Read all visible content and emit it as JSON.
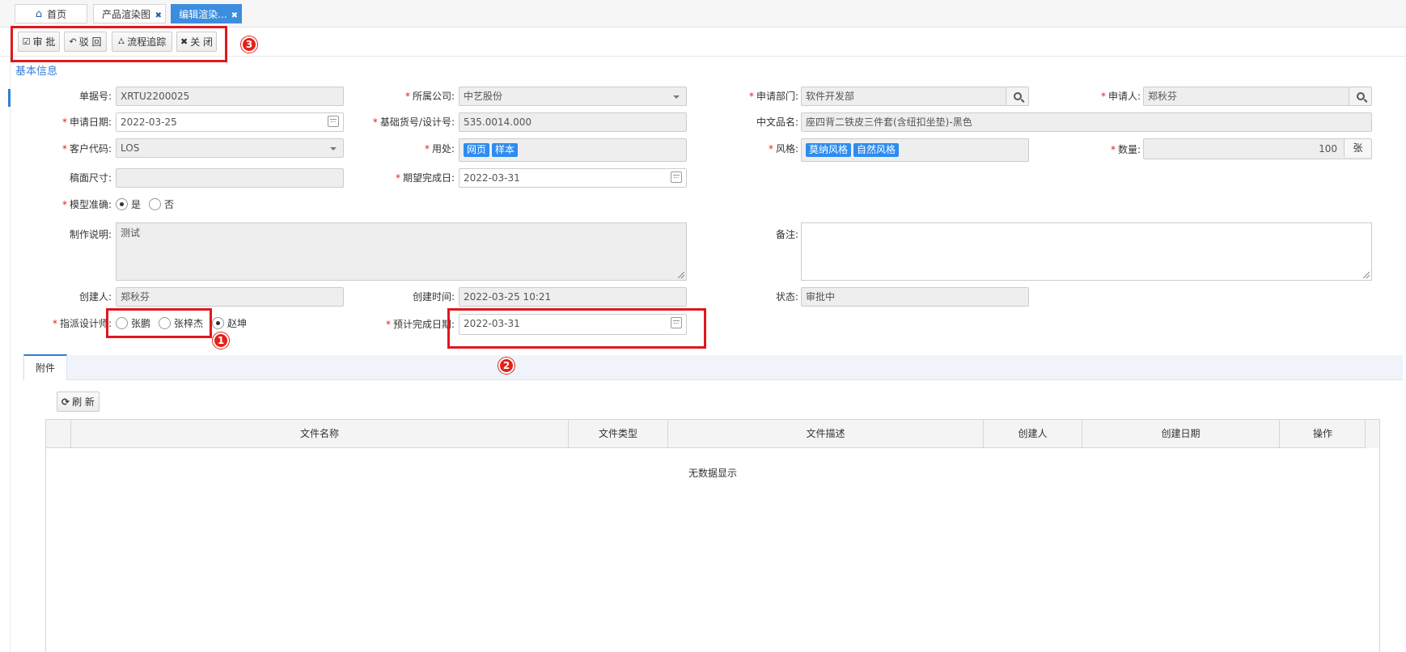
{
  "tabs": [
    {
      "label": "首页",
      "icon": "home-icon"
    },
    {
      "label": "产品渲染图",
      "close": "✖"
    },
    {
      "label": "编辑渲染...",
      "close": "✖"
    }
  ],
  "toolbar": {
    "approve": "审 批",
    "reject": "驳 回",
    "trace": "流程追踪",
    "close": "关 闭"
  },
  "section_title": "基本信息",
  "form": {
    "doc_no": {
      "label": "单据号:",
      "value": "XRTU2200025"
    },
    "company": {
      "label": "所属公司:",
      "value": "中艺股份"
    },
    "dept": {
      "label": "申请部门:",
      "value": "软件开发部"
    },
    "applicant": {
      "label": "申请人:",
      "value": "郑秋芬"
    },
    "apply_date": {
      "label": "申请日期:",
      "value": "2022-03-25"
    },
    "base_no": {
      "label": "基础货号/设计号:",
      "value": "535.0014.000"
    },
    "cn_name": {
      "label": "中文品名:",
      "value": "座四背二铁皮三件套(含纽扣坐垫)-黑色"
    },
    "customer": {
      "label": "客户代码:",
      "value": "LOS"
    },
    "usage": {
      "label": "用处:",
      "tags": [
        "网页",
        "样本"
      ]
    },
    "style": {
      "label": "风格:",
      "tags": [
        "莫纳风格",
        "自然风格"
      ]
    },
    "qty": {
      "label": "数量:",
      "value": "100",
      "unit": "张"
    },
    "draft_size": {
      "label": "稿面尺寸:",
      "value": ""
    },
    "expect_date": {
      "label": "期望完成日:",
      "value": "2022-03-31"
    },
    "model_ok": {
      "label": "模型准确:",
      "yes": "是",
      "no": "否"
    },
    "desc": {
      "label": "制作说明:",
      "value": "测试"
    },
    "remark": {
      "label": "备注:",
      "value": ""
    },
    "creator": {
      "label": "创建人:",
      "value": "郑秋芬"
    },
    "create_time": {
      "label": "创建时间:",
      "value": "2022-03-25 10:21"
    },
    "status": {
      "label": "状态:",
      "value": "审批中"
    },
    "designer": {
      "label": "指派设计师:",
      "options": [
        "张鹏",
        "张梓杰",
        "赵坤"
      ],
      "selected": "赵坤"
    },
    "plan_date": {
      "label": "预计完成日期:",
      "value": "2022-03-31"
    }
  },
  "attachments": {
    "tab": "附件",
    "refresh": "刷 新",
    "columns": [
      "文件名称",
      "文件类型",
      "文件描述",
      "创建人",
      "创建日期",
      "操作"
    ],
    "empty": "无数据显示"
  },
  "annotations": [
    "1",
    "2",
    "3"
  ],
  "colors": {
    "accent": "#2f7ed8",
    "tag": "#2d8cf0",
    "required": "#e02020",
    "highlight": "#e0171e"
  }
}
